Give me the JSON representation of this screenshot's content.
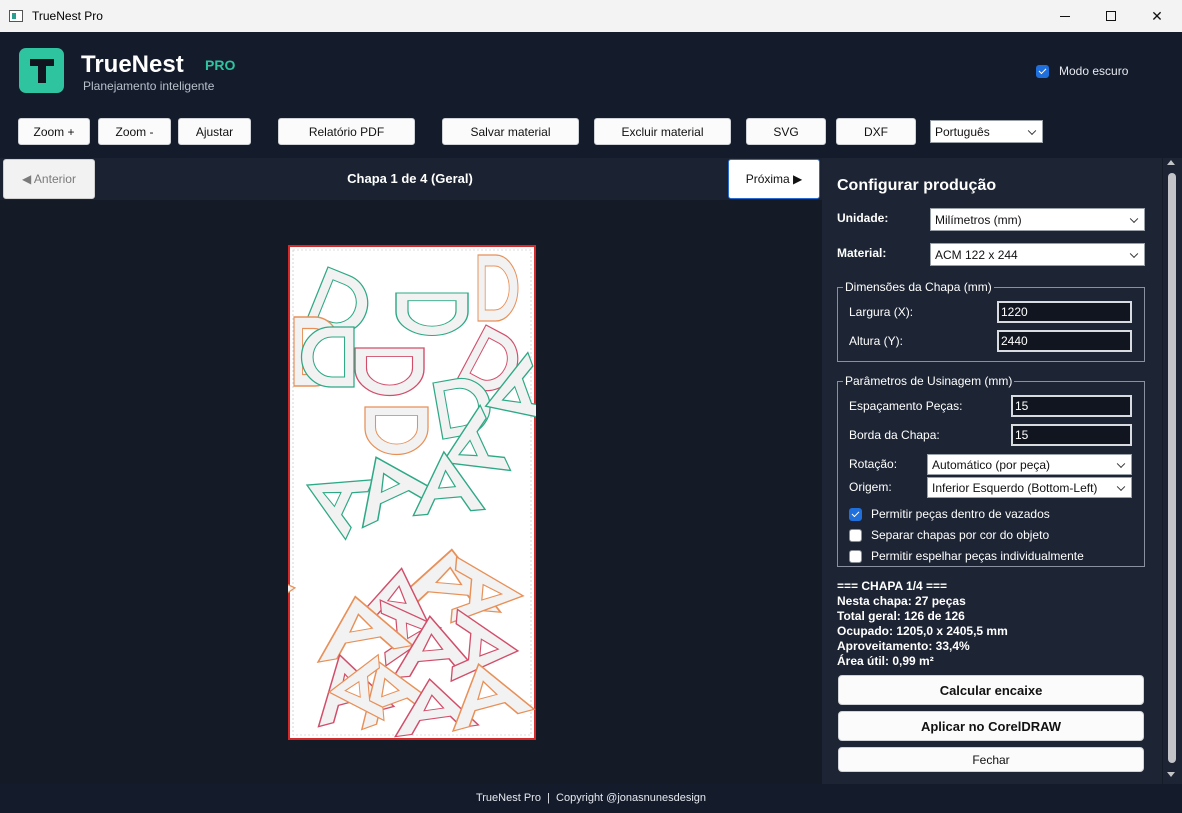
{
  "window": {
    "title": "TrueNest Pro"
  },
  "header": {
    "brand": "TrueNest",
    "brand_badge": "PRO",
    "tagline": "Planejamento inteligente",
    "dark_mode_label": "Modo escuro",
    "dark_mode_checked": true,
    "accent_color": "#2ec4a0"
  },
  "toolbar": {
    "zoom_in": "Zoom +",
    "zoom_out": "Zoom -",
    "fit": "Ajustar",
    "pdf_report": "Relatório PDF",
    "save_material": "Salvar material",
    "delete_material": "Excluir material",
    "svg": "SVG",
    "dxf": "DXF",
    "language": "Português"
  },
  "nav": {
    "prev": "◀ Anterior",
    "next": "Próxima ▶",
    "sheet_title": "Chapa 1 de 4 (Geral)"
  },
  "panel": {
    "title": "Configurar produção",
    "unit_label": "Unidade:",
    "unit_value": "Milímetros (mm)",
    "material_label": "Material:",
    "material_value": "ACM 122 x 244",
    "dims_group": "Dimensões da Chapa (mm)",
    "width_label": "Largura (X):",
    "width_value": "1220",
    "height_label": "Altura (Y):",
    "height_value": "2440",
    "machining_group": "Parâmetros de Usinagem (mm)",
    "spacing_label": "Espaçamento Peças:",
    "spacing_value": "15",
    "border_label": "Borda da Chapa:",
    "border_value": "15",
    "rotation_label": "Rotação:",
    "rotation_value": "Automático (por peça)",
    "origin_label": "Origem:",
    "origin_value": "Inferior Esquerdo (Bottom-Left)",
    "options": [
      {
        "label": "Permitir peças dentro de vazados",
        "checked": true
      },
      {
        "label": "Separar chapas por cor do objeto",
        "checked": false
      },
      {
        "label": "Permitir espelhar peças individualmente",
        "checked": false
      }
    ]
  },
  "stats": {
    "header": "=== CHAPA 1/4 ===",
    "pieces": "Nesta chapa: 27 peças",
    "total": "Total geral: 126 de 126",
    "occupied": "Ocupado: 1205,0 x 2405,5 mm",
    "usage": "Aproveitamento: 33,4%",
    "area": "Área útil: 0,99 m²"
  },
  "actions": {
    "calculate": "Calcular encaixe",
    "apply": "Aplicar no CorelDRAW",
    "close": "Fechar"
  },
  "footer": {
    "text": "TrueNest Pro  |  Copyright @jonasnunesdesign"
  },
  "sheet": {
    "border_color": "#d62a2a",
    "piece_colors": [
      "#2ea985",
      "#e89058",
      "#d14e6a"
    ]
  }
}
